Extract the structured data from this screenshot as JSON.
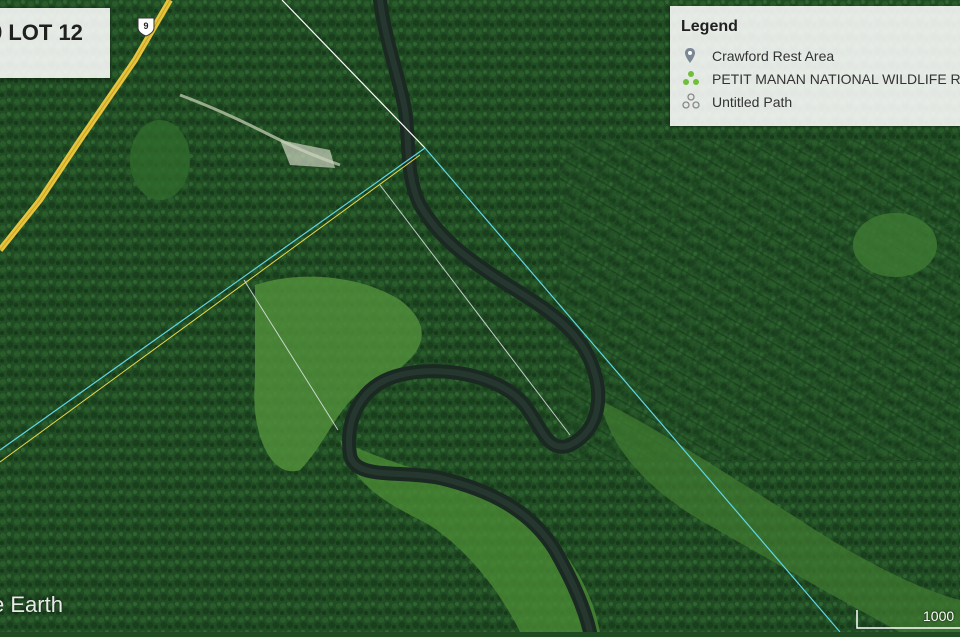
{
  "map": {
    "title": "9 LOT 12",
    "road_shield": "9",
    "watermark": "e Earth",
    "scale_label": "1000"
  },
  "legend": {
    "title": "Legend",
    "items": [
      {
        "label": "Crawford Rest Area",
        "icon": "placemark-icon"
      },
      {
        "label": "PETIT MANAN NATIONAL WILDLIFE R",
        "icon": "polygon-icon"
      },
      {
        "label": "Untitled Path",
        "icon": "path-icon"
      }
    ]
  },
  "colors": {
    "road": "#e8c43a",
    "boundary_white": "#ffffff",
    "boundary_cyan": "#5fd6e6",
    "boundary_yellow": "#e6d84a",
    "river": "#1a2a22",
    "marsh": "#4e8a3a",
    "forest": "#1f4a22"
  }
}
